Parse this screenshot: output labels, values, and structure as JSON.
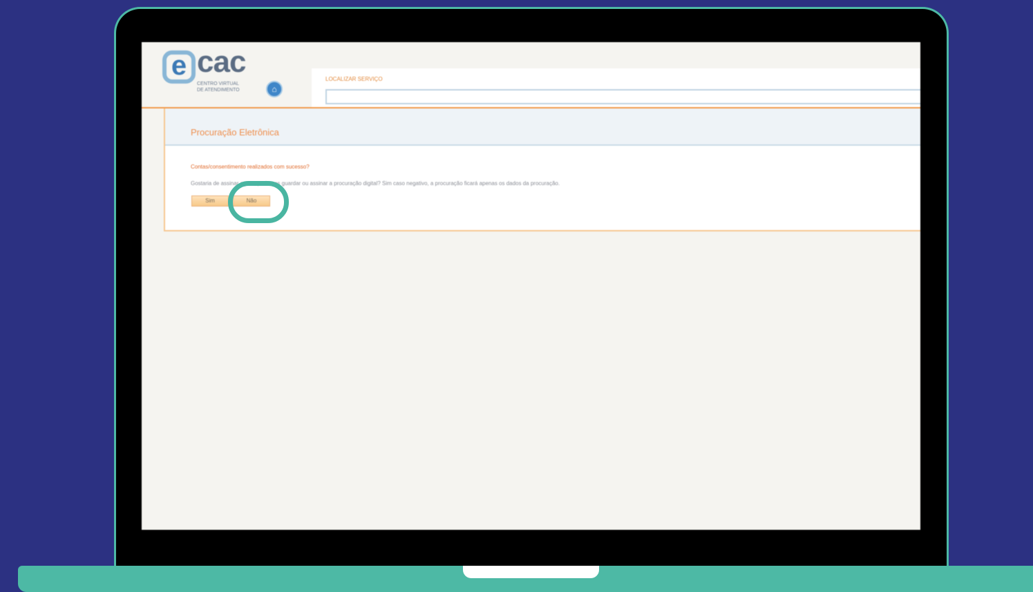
{
  "logo": {
    "e_letter": "e",
    "name": "cac",
    "subtitle_line1": "CENTRO VIRTUAL",
    "subtitle_line2": "DE ATENDIMENTO"
  },
  "search": {
    "label": "LOCALIZAR SERVIÇO",
    "value": ""
  },
  "panel": {
    "title": "Procuração Eletrônica",
    "question_title": "Contas/consentimento realizados com sucesso?",
    "question_text": "Gostaria de assinar agora, podemos guardar ou assinar a procuração digital? Sim caso negativo, a procuração ficará apenas os dados da procuração.",
    "buttons": {
      "yes": "Sim",
      "no": "Não"
    }
  },
  "colors": {
    "background": "#2c3182",
    "laptop_accent": "#4db9a5",
    "highlight": "#49b5a1",
    "orange": "#f19a4a"
  },
  "icons": {
    "home": "home-icon"
  }
}
